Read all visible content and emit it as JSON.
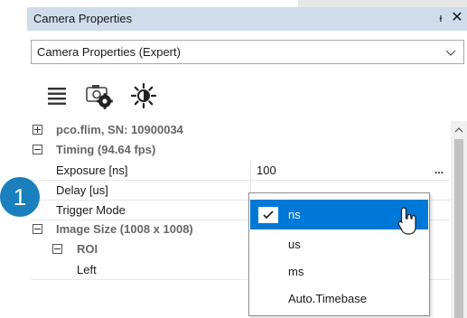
{
  "window": {
    "title": "Camera Properties",
    "pin_glyph": "ᵼ",
    "close_glyph": "✕"
  },
  "mode_select": {
    "value": "Camera Properties (Expert)"
  },
  "toolbar": {
    "icons": [
      "list-icon",
      "camera-settings-icon",
      "brightness-icon"
    ]
  },
  "property_grid": {
    "camera_category": "pco.flim, SN: 10900034",
    "timing_category": "Timing (94.64 fps)",
    "exposure_label": "Exposure [ns]",
    "exposure_value": "100",
    "ellipsis": "...",
    "delay_label": "Delay [us]",
    "trigger_label": "Trigger Mode",
    "image_size_category": "Image Size (1008 x 1008)",
    "roi_category": "ROI",
    "left_label": "Left"
  },
  "unit_dropdown": {
    "options": [
      "ns",
      "us",
      "ms",
      "Auto.Timebase"
    ],
    "selected": "ns"
  },
  "badge": {
    "number": "1"
  },
  "colors": {
    "accent": "#0078d7",
    "titlebar": "#cfdceb",
    "badge": "#1a7fbd"
  }
}
